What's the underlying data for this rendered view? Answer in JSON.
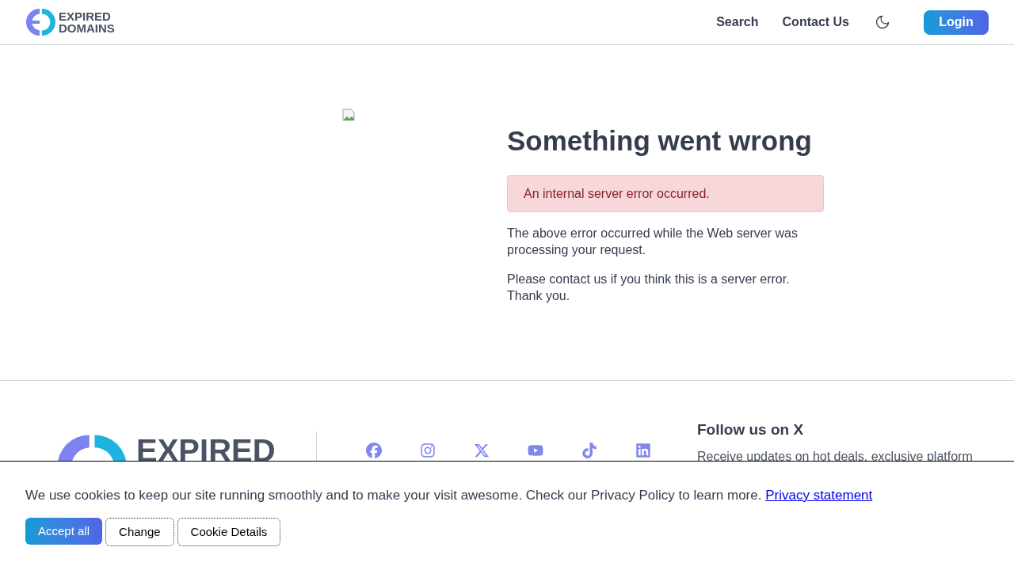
{
  "header": {
    "logo_lines": [
      "EXPIRED",
      "DOMAINS"
    ],
    "nav": [
      "Search",
      "Contact Us"
    ],
    "login": "Login"
  },
  "error": {
    "title": "Something went wrong",
    "alert": "An internal server error occurred.",
    "paragraphs": [
      "The above error occurred while the Web server was processing your request.",
      "Please contact us if you think this is a server error. Thank you."
    ]
  },
  "footer": {
    "logo_text": "EXPIRED",
    "social": [
      {
        "kind": "facebook"
      },
      {
        "kind": "instagram"
      },
      {
        "kind": "x"
      },
      {
        "kind": "youtube"
      },
      {
        "kind": "tiktok"
      },
      {
        "kind": "linkedin"
      }
    ],
    "follow_title": "Follow us on X",
    "follow_text": "Receive updates on hot deals, exclusive platform"
  },
  "cookie_banner": {
    "text": "We use cookies to keep our site running smoothly and to make your visit awesome. Check our Privacy Policy to learn more.",
    "link": "Privacy statement",
    "buttons": [
      {
        "label": "Accept all",
        "kind": "primary"
      },
      {
        "label": "Change",
        "kind": "outline"
      },
      {
        "label": "Cookie Details",
        "kind": "outline"
      }
    ]
  }
}
